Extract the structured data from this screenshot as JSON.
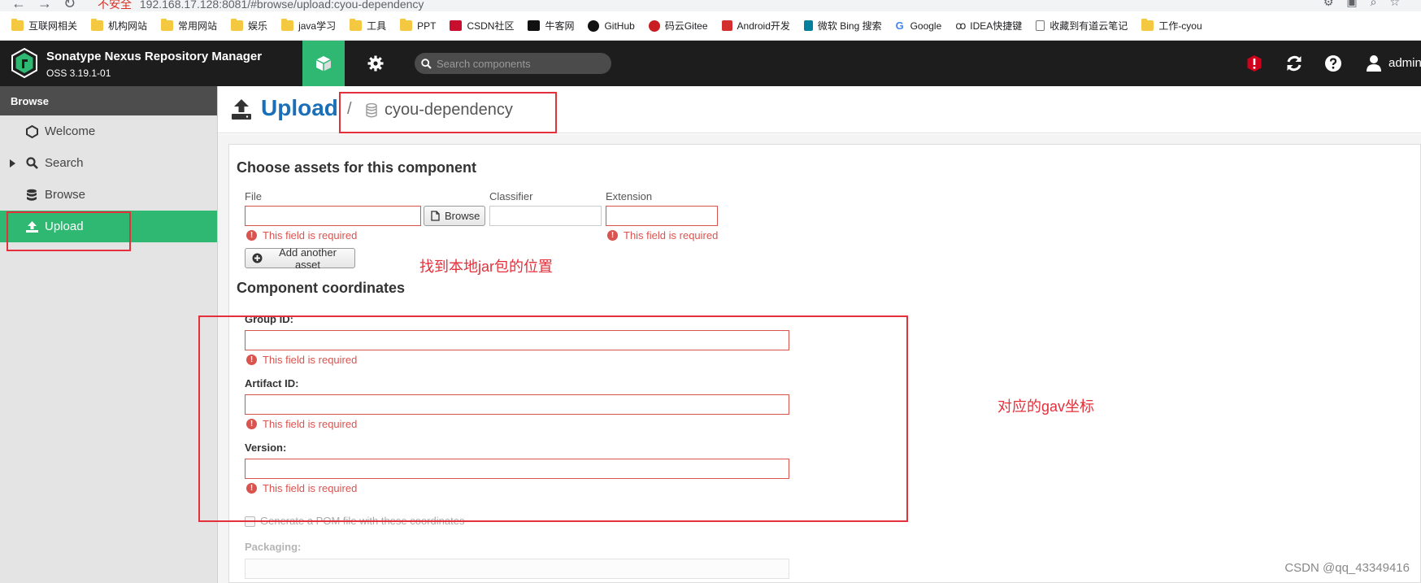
{
  "browser": {
    "url_warning": "不安全",
    "url": "192.168.17.128:8081/#browse/upload:cyou-dependency",
    "bookmarks": [
      {
        "label": "互联网相关",
        "icon": "folder-icon"
      },
      {
        "label": "机构网站",
        "icon": "folder-icon"
      },
      {
        "label": "常用网站",
        "icon": "folder-icon"
      },
      {
        "label": "娱乐",
        "icon": "folder-icon"
      },
      {
        "label": "java学习",
        "icon": "folder-icon"
      },
      {
        "label": "工具",
        "icon": "folder-icon"
      },
      {
        "label": "PPT",
        "icon": "folder-icon"
      },
      {
        "label": "CSDN社区",
        "icon": "csdn-icon"
      },
      {
        "label": "牛客网",
        "icon": "nowcoder-icon"
      },
      {
        "label": "GitHub",
        "icon": "github-icon"
      },
      {
        "label": "码云Gitee",
        "icon": "gitee-icon"
      },
      {
        "label": "Android开发",
        "icon": "android-icon"
      },
      {
        "label": "微软 Bing 搜索",
        "icon": "bing-icon"
      },
      {
        "label": "Google",
        "icon": "google-icon"
      },
      {
        "label": "IDEA快捷键",
        "icon": "idea-icon"
      },
      {
        "label": "收藏到有道云笔记",
        "icon": "document-icon"
      },
      {
        "label": "工作-cyou",
        "icon": "folder-icon"
      }
    ]
  },
  "header": {
    "product_name": "Sonatype Nexus Repository Manager",
    "version": "OSS 3.19.1-01",
    "search_placeholder": "Search components",
    "user": "admin"
  },
  "sidebar": {
    "title": "Browse",
    "items": [
      {
        "label": "Welcome",
        "icon": "hexagon-icon",
        "active": false
      },
      {
        "label": "Search",
        "icon": "search-icon",
        "active": false,
        "expandable": true
      },
      {
        "label": "Browse",
        "icon": "database-icon",
        "active": false
      },
      {
        "label": "Upload",
        "icon": "upload-icon",
        "active": true
      }
    ]
  },
  "page": {
    "title": "Upload",
    "separator": "/",
    "repository": "cyou-dependency"
  },
  "assets_section": {
    "title": "Choose assets for this component",
    "file_label": "File",
    "classifier_label": "Classifier",
    "extension_label": "Extension",
    "browse_button": "Browse",
    "add_asset_button": "Add another asset",
    "required_error": "This field is required"
  },
  "coordinates_section": {
    "title": "Component coordinates",
    "group_id_label": "Group ID:",
    "artifact_id_label": "Artifact ID:",
    "version_label": "Version:",
    "required_error": "This field is required",
    "generate_pom_label": "Generate a POM file with these coordinates",
    "packaging_label": "Packaging:"
  },
  "annotations": {
    "jar_location": "找到本地jar包的位置",
    "gav_coordinates": "对应的gav坐标"
  },
  "watermark": "CSDN @qq_43349416",
  "colors": {
    "nexus_green": "#2eb872",
    "header_dark": "#1d1d1d",
    "title_blue": "#1a6fb8",
    "error_red": "#d9534f",
    "annotation_red": "#e3303b"
  }
}
